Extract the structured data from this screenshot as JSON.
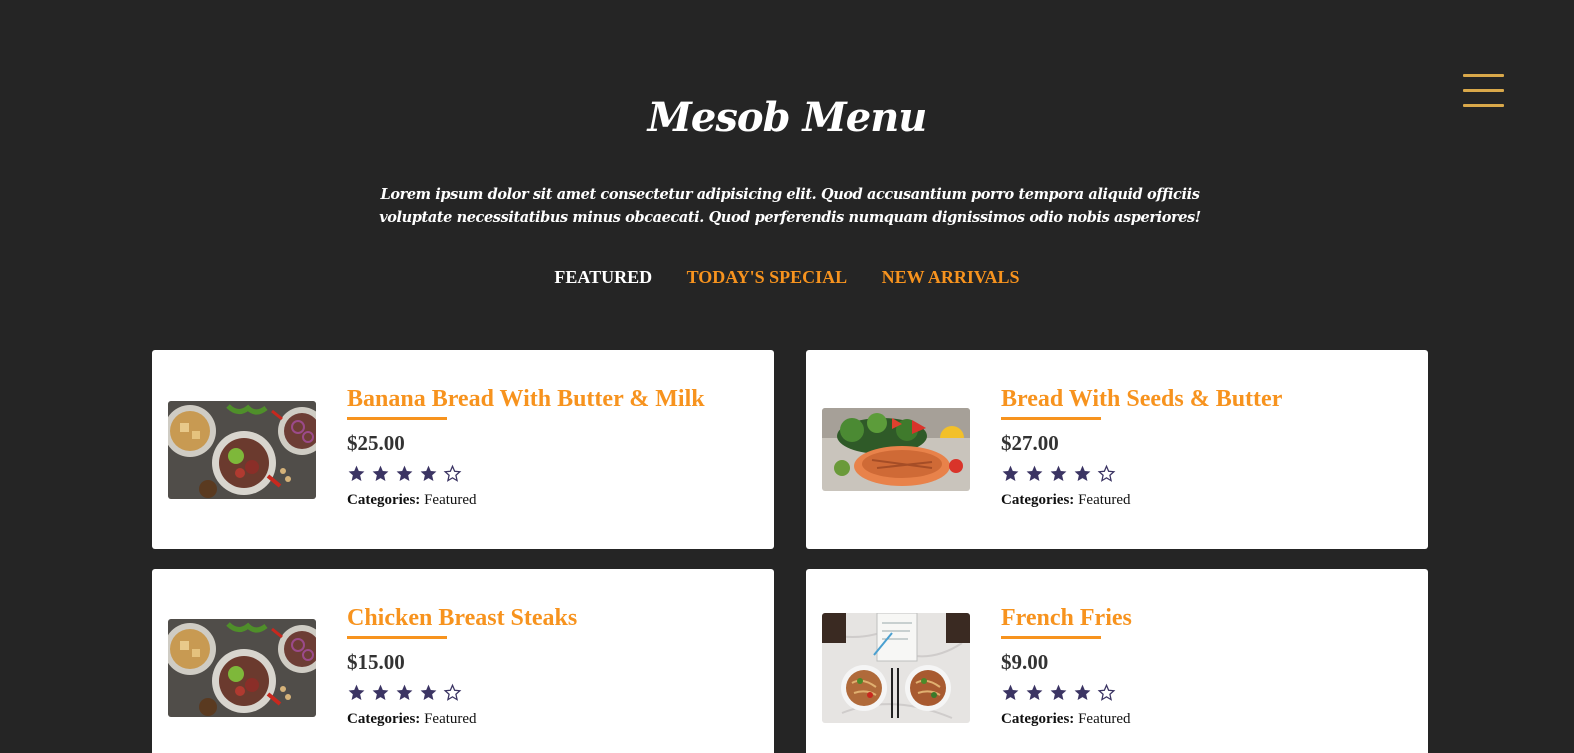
{
  "header": {
    "title": "Mesob Menu",
    "description": "Lorem ipsum dolor sit amet consectetur adipisicing elit. Quod accusantium porro tempora aliquid officiis voluptate necessitatibus minus obcaecati. Quod perferendis numquam dignissimos odio nobis asperiores!",
    "menu_icon": "hamburger-menu-icon"
  },
  "tabs": [
    {
      "label": "FEATURED",
      "active": true
    },
    {
      "label": "TODAY'S SPECIAL",
      "active": false
    },
    {
      "label": "NEW ARRIVALS",
      "active": false
    }
  ],
  "items": [
    {
      "name": "Banana Bread With Butter & Milk",
      "price": "$25.00",
      "rating": 4,
      "max_rating": 5,
      "categories_label": "Categories:",
      "category": "Featured",
      "image": "bowls-of-salad-and-meat-photo"
    },
    {
      "name": "Bread With Seeds & Butter",
      "price": "$27.00",
      "rating": 4,
      "max_rating": 5,
      "categories_label": "Categories:",
      "category": "Featured",
      "image": "grilled-salmon-with-salad-photo"
    },
    {
      "name": "Chicken Breast Steaks",
      "price": "$15.00",
      "rating": 4,
      "max_rating": 5,
      "categories_label": "Categories:",
      "category": "Featured",
      "image": "bowls-of-salad-and-meat-photo"
    },
    {
      "name": "French Fries",
      "price": "$9.00",
      "rating": 4,
      "max_rating": 5,
      "categories_label": "Categories:",
      "category": "Featured",
      "image": "noodle-bowls-on-marble-table-photo"
    }
  ],
  "colors": {
    "background": "#252525",
    "accent": "#f7931e",
    "menu_icon": "#d9a84a",
    "star": "#3b3463"
  }
}
